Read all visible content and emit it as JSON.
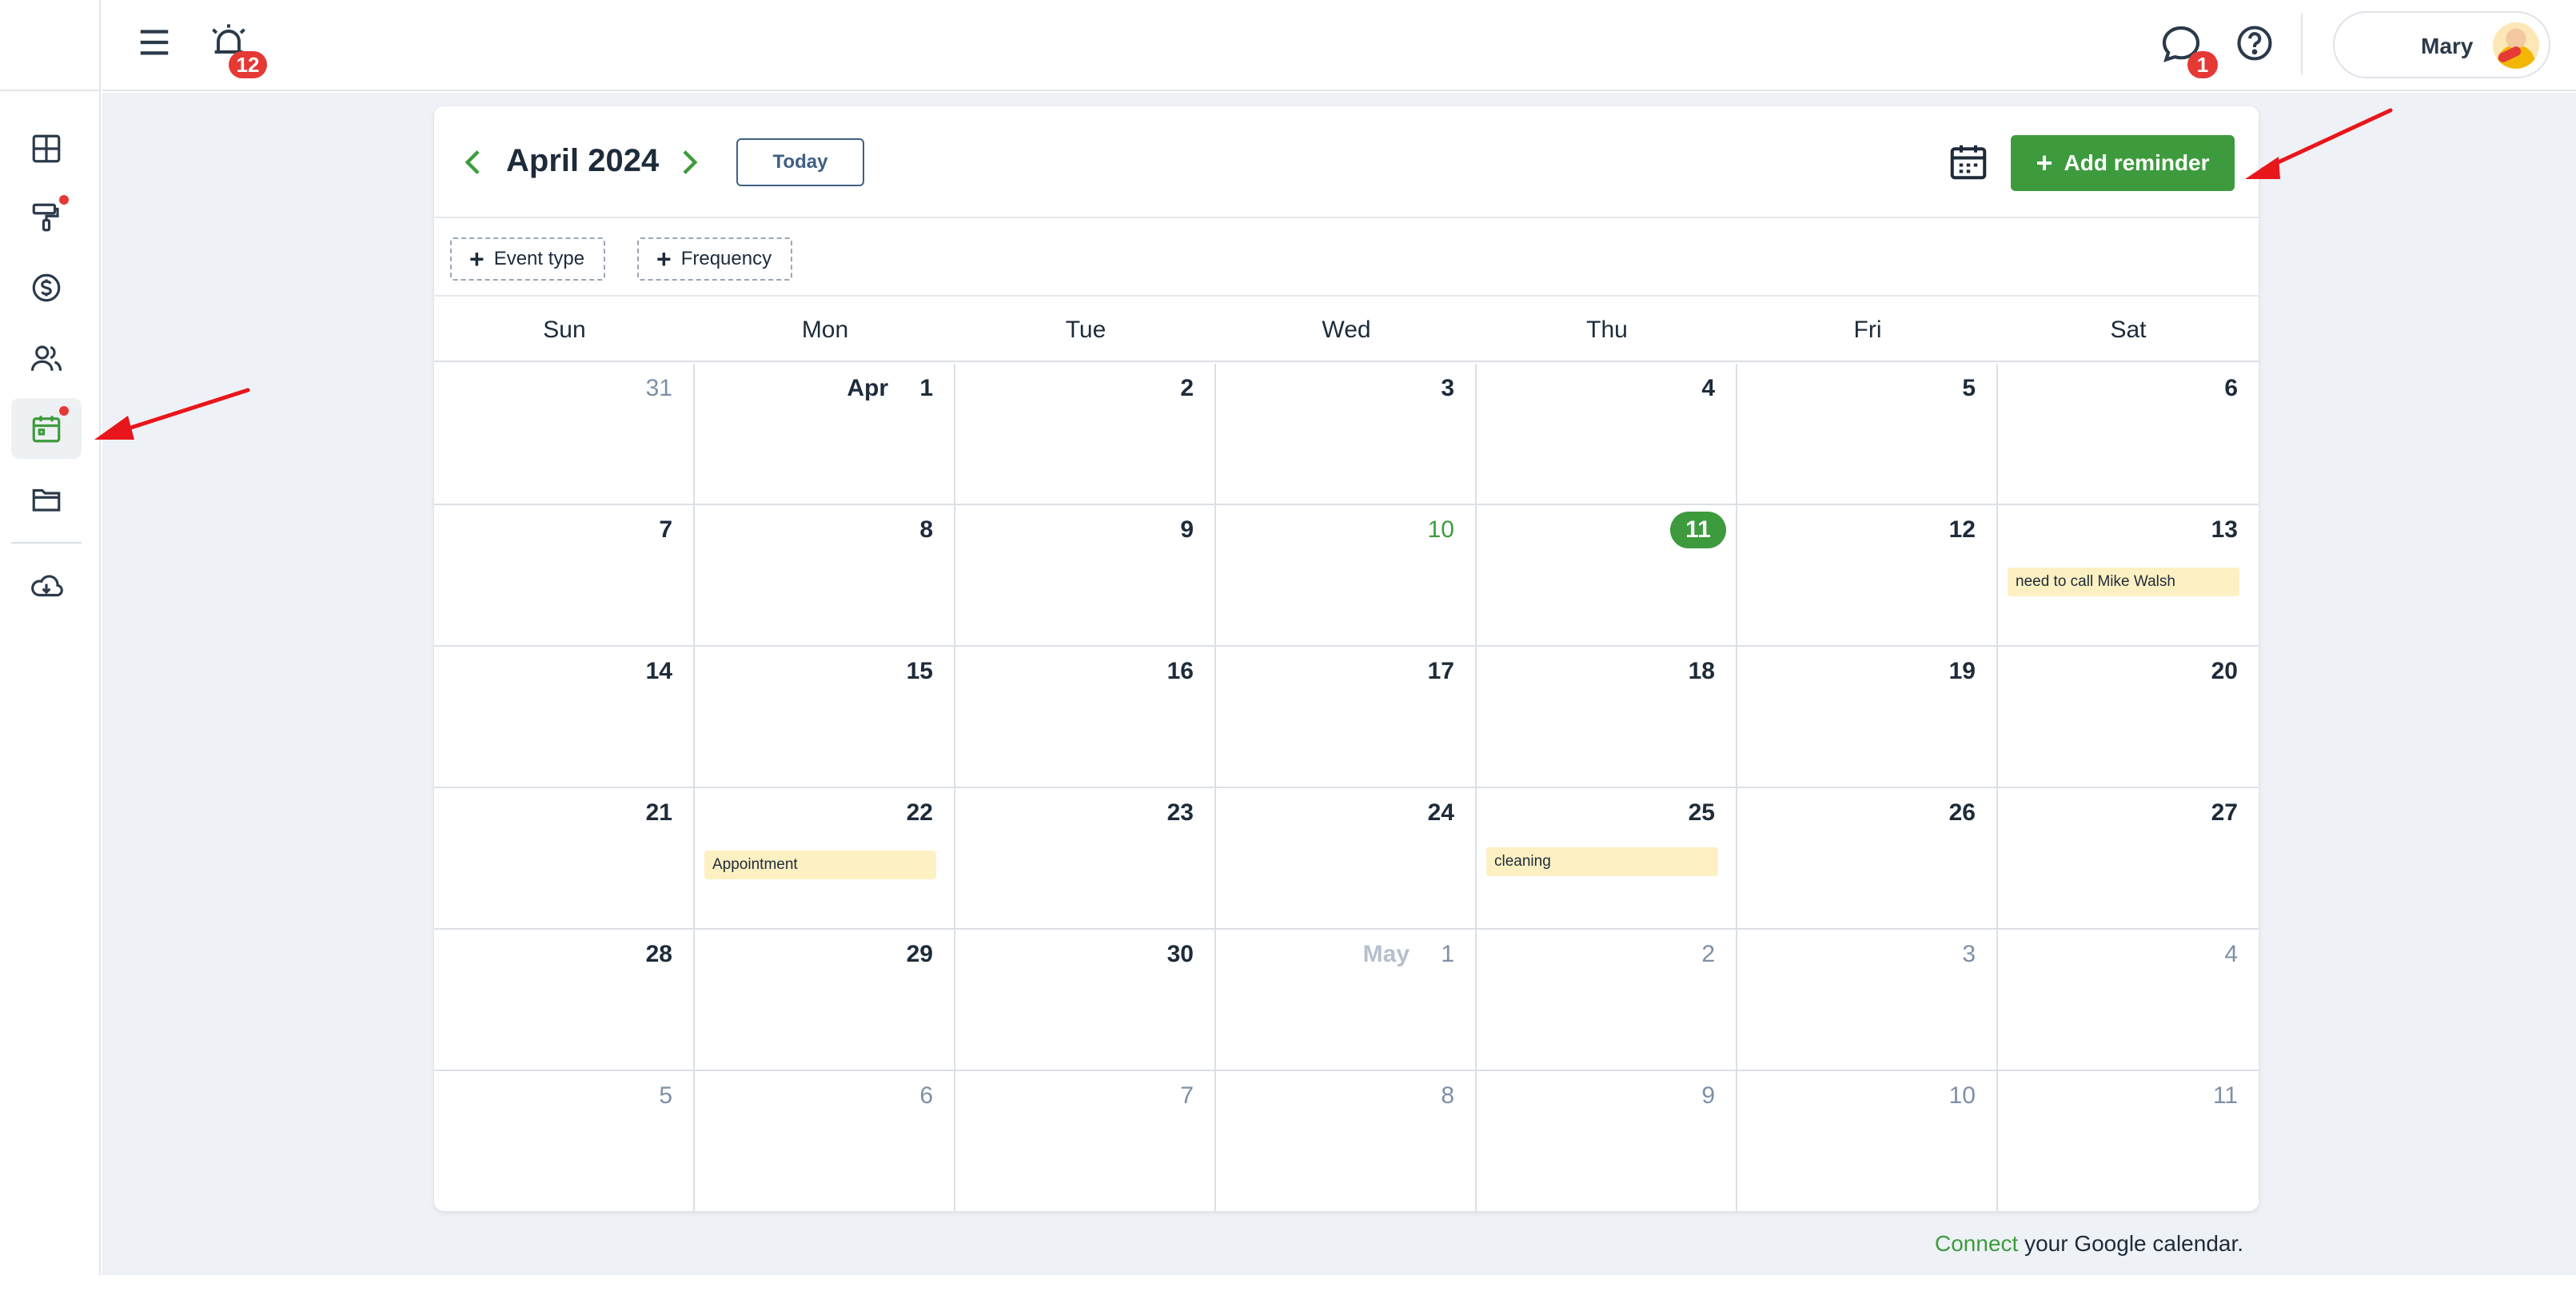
{
  "sidebar": {
    "items": [
      {
        "icon": "dashboard-icon"
      },
      {
        "icon": "paint-roller-icon",
        "dot": true
      },
      {
        "icon": "dollar-icon"
      },
      {
        "icon": "users-icon"
      },
      {
        "icon": "calendar-icon",
        "dot": true,
        "active": true
      },
      {
        "icon": "folder-icon"
      },
      {
        "icon": "cloud-download-icon"
      }
    ]
  },
  "topbar": {
    "alarm_badge": "12",
    "chat_badge": "1",
    "user_name": "Mary"
  },
  "calendar": {
    "month_title": "April 2024",
    "today_label": "Today",
    "add_reminder_label": "Add reminder",
    "filters": [
      "Event type",
      "Frequency"
    ],
    "weekdays": [
      "Sun",
      "Mon",
      "Tue",
      "Wed",
      "Thu",
      "Fri",
      "Sat"
    ],
    "weeks": [
      [
        {
          "day": "31",
          "muted": true
        },
        {
          "day": "1",
          "prefix": "Apr"
        },
        {
          "day": "2"
        },
        {
          "day": "3"
        },
        {
          "day": "4"
        },
        {
          "day": "5"
        },
        {
          "day": "6"
        }
      ],
      [
        {
          "day": "7"
        },
        {
          "day": "8"
        },
        {
          "day": "9"
        },
        {
          "day": "10",
          "green": true
        },
        {
          "day": "11",
          "today": true
        },
        {
          "day": "12"
        },
        {
          "day": "13",
          "event": "need to call Mike Walsh"
        }
      ],
      [
        {
          "day": "14"
        },
        {
          "day": "15"
        },
        {
          "day": "16"
        },
        {
          "day": "17"
        },
        {
          "day": "18"
        },
        {
          "day": "19"
        },
        {
          "day": "20"
        }
      ],
      [
        {
          "day": "21"
        },
        {
          "day": "22",
          "event": "Appointment"
        },
        {
          "day": "23"
        },
        {
          "day": "24"
        },
        {
          "day": "25",
          "event": "cleaning"
        },
        {
          "day": "26"
        },
        {
          "day": "27"
        }
      ],
      [
        {
          "day": "28"
        },
        {
          "day": "29"
        },
        {
          "day": "30"
        },
        {
          "day": "1",
          "prefix": "May",
          "muted": true
        },
        {
          "day": "2",
          "muted": true
        },
        {
          "day": "3",
          "muted": true
        },
        {
          "day": "4",
          "muted": true
        }
      ],
      [
        {
          "day": "5",
          "muted": true
        },
        {
          "day": "6",
          "muted": true
        },
        {
          "day": "7",
          "muted": true
        },
        {
          "day": "8",
          "muted": true
        },
        {
          "day": "9",
          "muted": true
        },
        {
          "day": "10",
          "muted": true
        },
        {
          "day": "11",
          "muted": true
        }
      ]
    ]
  },
  "footer": {
    "connect_link": "Connect",
    "connect_text": " your Google calendar."
  },
  "colors": {
    "accent_green": "#3d9b3d",
    "badge_red": "#e53935",
    "event_yellow": "#fdf0c2",
    "annotation_red": "#e8161b"
  }
}
